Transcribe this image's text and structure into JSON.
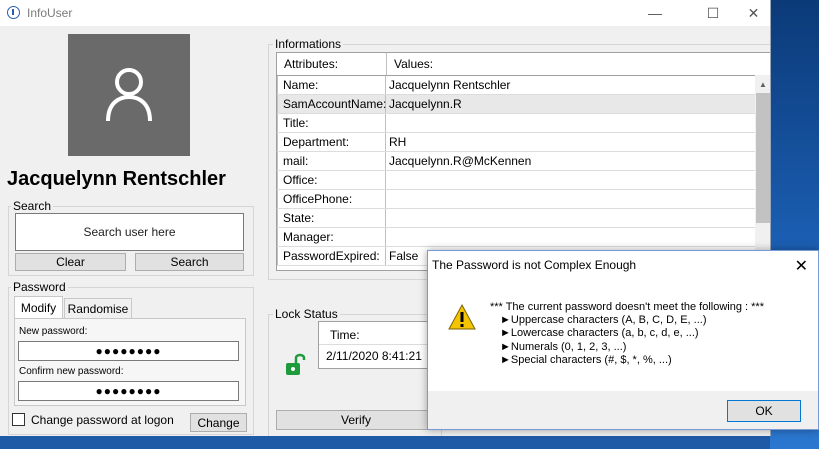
{
  "window": {
    "title": "InfoUser",
    "minimize_glyph": "—",
    "maximize_glyph": "☐",
    "close_glyph": "✕"
  },
  "profile": {
    "name": "Jacquelynn Rentschler",
    "avatar_icon": "user-icon"
  },
  "search": {
    "legend": "Search",
    "placeholder": "Search user here",
    "clear_label": "Clear",
    "search_label": "Search"
  },
  "password": {
    "legend": "Password",
    "tabs": [
      "Modify",
      "Randomise"
    ],
    "new_label": "New password:",
    "new_value": "●●●●●●●●",
    "confirm_label": "Confirm new password:",
    "confirm_value": "●●●●●●●●",
    "change_at_logon_label": "Change password at logon",
    "change_label": "Change"
  },
  "informations": {
    "legend": "Informations",
    "columns": [
      "Attributes:",
      "Values:"
    ],
    "rows": [
      {
        "attr": "Name:",
        "value": "Jacquelynn Rentschler"
      },
      {
        "attr": "SamAccountName:",
        "value": "Jacquelynn.R"
      },
      {
        "attr": "Title:",
        "value": ""
      },
      {
        "attr": "Department:",
        "value": "RH"
      },
      {
        "attr": "mail:",
        "value": "Jacquelynn.R@McKennen"
      },
      {
        "attr": "Office:",
        "value": ""
      },
      {
        "attr": "OfficePhone:",
        "value": ""
      },
      {
        "attr": "State:",
        "value": ""
      },
      {
        "attr": "Manager:",
        "value": ""
      },
      {
        "attr": "PasswordExpired:",
        "value": "False"
      }
    ]
  },
  "lock_status": {
    "legend": "Lock Status",
    "time_header": "Time:",
    "time_value": "2/11/2020 8:41:21",
    "verify_label": "Verify",
    "lock_icon": "unlocked-padlock-icon",
    "lock_color": "#1e9b3a"
  },
  "dialog": {
    "title": "The Password is not Complex Enough",
    "close_glyph": "✕",
    "icon": "warning-icon",
    "lines": [
      "*** The current password doesn't meet the following : ***",
      "►Uppercase characters (A, B, C, D, E, ...)",
      "►Lowercase characters (a, b, c, d, e, ...)",
      "►Numerals (0, 1, 2, 3, ...)",
      "►Special characters (#, $, *, %, ...)"
    ],
    "ok_label": "OK"
  }
}
